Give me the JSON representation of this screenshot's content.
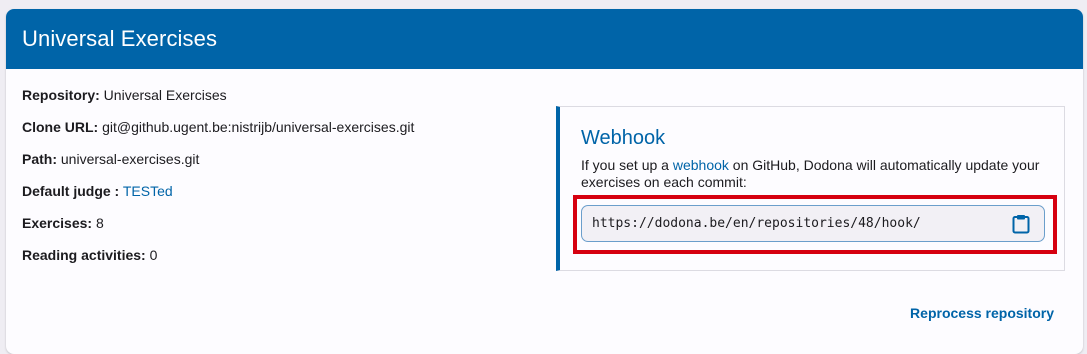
{
  "card": {
    "title": "Universal Exercises"
  },
  "info": {
    "repository_label": "Repository:",
    "repository_value": " Universal Exercises",
    "clone_url_label": "Clone URL:",
    "clone_url_value": " git@github.ugent.be:nistrijb/universal-exercises.git",
    "path_label": "Path:",
    "path_value": " universal-exercises.git",
    "default_judge_label": "Default judge :",
    "default_judge_value": "TESTed",
    "exercises_label": "Exercises:",
    "exercises_value": " 8",
    "reading_label": "Reading activities:",
    "reading_value": " 0"
  },
  "webhook": {
    "title": "Webhook",
    "desc_before": "If you set up a ",
    "desc_link": "webhook",
    "desc_after": " on GitHub, Dodona will automatically update your exercises on each commit:",
    "url": "https://dodona.be/en/repositories/48/hook/",
    "copy_icon": "clipboard-icon"
  },
  "actions": {
    "reprocess_label": "Reprocess repository"
  },
  "colors": {
    "primary": "#0064a8",
    "highlight": "#d60010",
    "background": "#efedf3"
  }
}
